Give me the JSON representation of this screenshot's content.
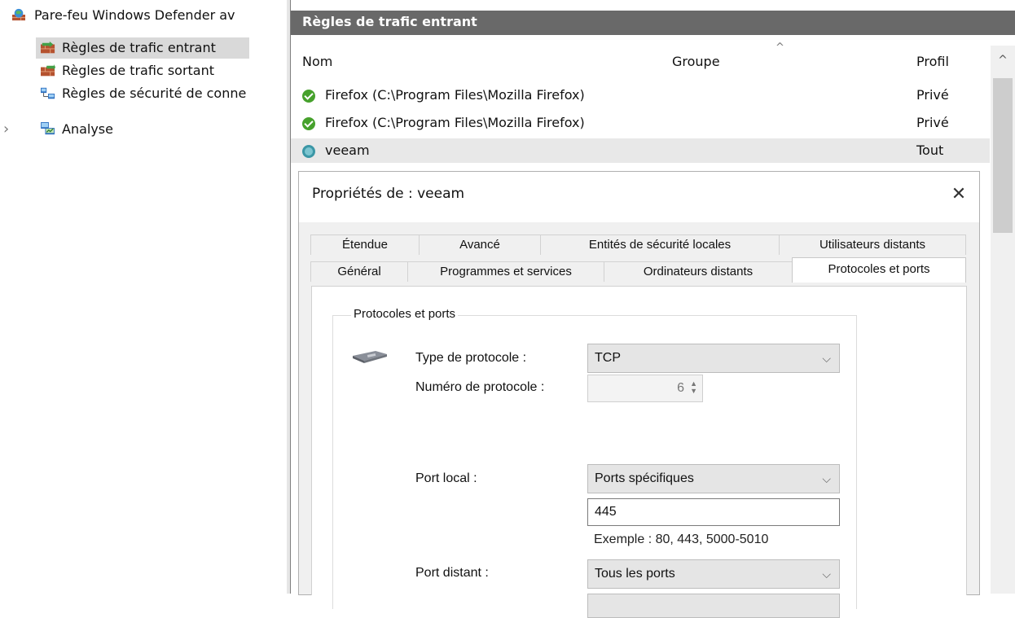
{
  "tree": {
    "root_label": "Pare-feu Windows Defender av",
    "items": [
      {
        "label": "Règles de trafic entrant",
        "selected": true
      },
      {
        "label": "Règles de trafic sortant",
        "selected": false
      },
      {
        "label": "Règles de sécurité de conne",
        "selected": false
      },
      {
        "label": "Analyse",
        "selected": false
      }
    ]
  },
  "pane": {
    "title": "Règles de trafic entrant",
    "columns": {
      "name": "Nom",
      "group": "Groupe",
      "profile": "Profil"
    },
    "rows": [
      {
        "name": "Firefox (C:\\Program Files\\Mozilla Firefox)",
        "group": "",
        "profile": "Privé",
        "icon": "allow-icon"
      },
      {
        "name": "Firefox (C:\\Program Files\\Mozilla Firefox)",
        "group": "",
        "profile": "Privé",
        "icon": "allow-icon"
      },
      {
        "name": "veeam",
        "group": "",
        "profile": "Tout",
        "icon": "secure-allow-icon"
      }
    ]
  },
  "dialog": {
    "title": "Propriétés de : veeam",
    "close": "✕",
    "tabs_row1": [
      "Étendue",
      "Avancé",
      "Entités de sécurité locales",
      "Utilisateurs distants"
    ],
    "tabs_row2": [
      "Général",
      "Programmes et services",
      "Ordinateurs distants",
      "Protocoles et ports"
    ],
    "active_tab": "Protocoles et ports",
    "group_title": "Protocoles et ports",
    "protocol_type_label": "Type de protocole :",
    "protocol_type_value": "TCP",
    "protocol_number_label": "Numéro de protocole :",
    "protocol_number_value": "6",
    "local_port_label": "Port local :",
    "local_port_mode": "Ports spécifiques",
    "local_port_value": "445",
    "example_hint": "Exemple : 80, 443, 5000-5010",
    "remote_port_label": "Port distant :",
    "remote_port_mode": "Tous les ports"
  },
  "colors": {
    "pane_title_bg": "#696969",
    "selected_bg": "#d9d9d9",
    "dialog_bg": "#f0f0f0"
  }
}
